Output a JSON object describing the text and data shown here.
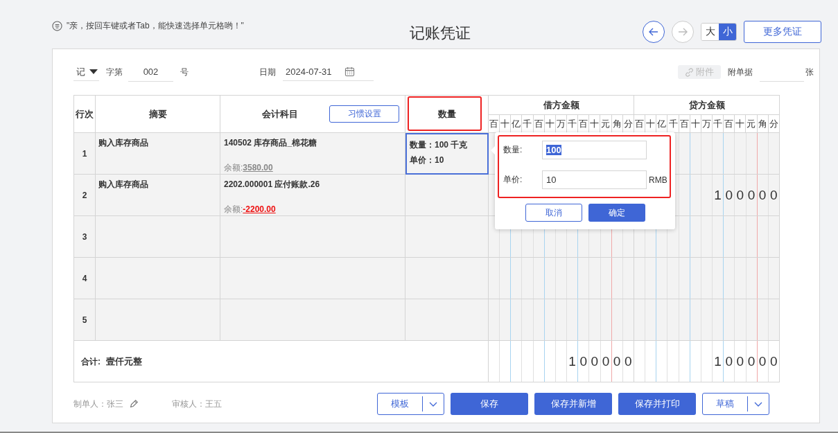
{
  "hint": {
    "text": "\"亲，按回车键或者Tab，能快速选择单元格哟！\""
  },
  "title": "记账凭证",
  "nav": {
    "prev_disabled": false,
    "next_disabled": true
  },
  "size_toggle": [
    {
      "label": "大",
      "selected": false
    },
    {
      "label": "小",
      "selected": true
    }
  ],
  "more_button": "更多凭证",
  "voucher": {
    "type": "记",
    "word_label": "字第",
    "number": "002",
    "number_suffix": "号",
    "date_label": "日期",
    "date": "2024-07-31",
    "attach_button": {
      "label": "附件",
      "disabled": true
    },
    "attach_label": "附单据",
    "attach_unit": "张"
  },
  "table": {
    "columns": {
      "row_no": "行次",
      "summary": "摘要",
      "account": "会计科目",
      "settings_button": "习惯设置",
      "quantity": "数量",
      "debit": "借方金额",
      "credit": "贷方金额",
      "debit_digits": [
        "百",
        "十",
        "亿",
        "千",
        "百",
        "十",
        "万",
        "千",
        "百",
        "十",
        "元",
        "角",
        "分"
      ],
      "credit_digits": [
        "百",
        "十",
        "亿",
        "千",
        "百",
        "十",
        "万",
        "千",
        "百",
        "十",
        "元",
        "角",
        "分"
      ]
    },
    "rows": [
      {
        "no": "1",
        "summary": "购入库存商品",
        "account": "140502 库存商品_棉花糖",
        "balance_label": "余额:",
        "balance": "3580.00",
        "balance_negative": false,
        "quantity_lines": [
          "数量：100 千克",
          "单价：10"
        ],
        "selected": true,
        "credit": ""
      },
      {
        "no": "2",
        "summary": "购入库存商品",
        "account": "2202.000001 应付账款.26",
        "balance_label": "余额:",
        "balance": "-2200.00",
        "balance_negative": true,
        "quantity_lines": [],
        "selected": false,
        "credit": "100000"
      },
      {
        "no": "3",
        "selected": false,
        "credit": ""
      },
      {
        "no": "4",
        "selected": false,
        "credit": ""
      },
      {
        "no": "5",
        "selected": false,
        "credit": ""
      }
    ],
    "total": {
      "label": "合计:",
      "amount_words": "壹仟元整",
      "debit": "100000",
      "credit": "100000"
    }
  },
  "popover": {
    "quantity_label": "数量:",
    "quantity": "100",
    "quantity_selected": true,
    "price_label": "单价:",
    "price": "10",
    "currency": "RMB",
    "cancel": "取消",
    "confirm": "确定"
  },
  "footer": {
    "maker": "制单人：张三",
    "reviewer": "审核人：王五",
    "buttons": [
      {
        "label": "模板",
        "kind": "split"
      },
      {
        "label": "保存",
        "kind": "primary"
      },
      {
        "label": "保存并新增",
        "kind": "primary"
      },
      {
        "label": "保存并打印",
        "kind": "primary"
      },
      {
        "label": "草稿",
        "kind": "split"
      }
    ]
  }
}
